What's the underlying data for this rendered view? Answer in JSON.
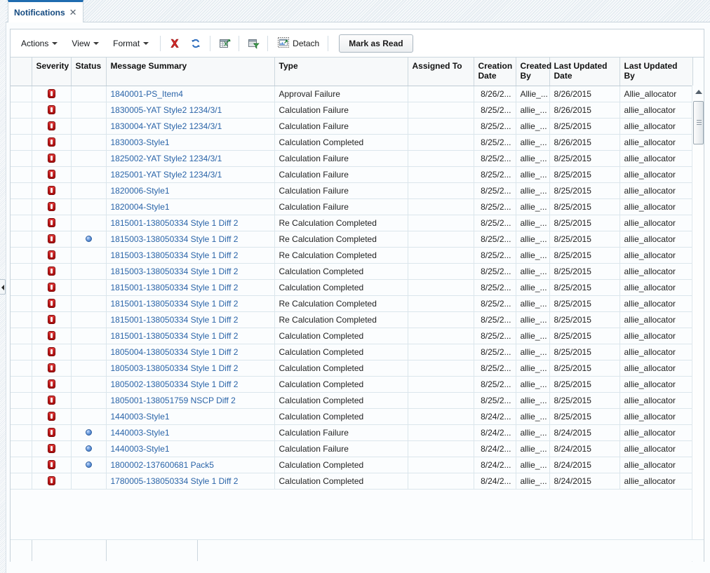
{
  "tab": {
    "label": "Notifications",
    "close_icon": "close-icon"
  },
  "toolbar": {
    "actions_label": "Actions",
    "view_label": "View",
    "format_label": "Format",
    "delete_icon": "delete-x-icon",
    "refresh_icon": "refresh-icon",
    "export_excel_icon": "export-to-excel-icon",
    "filter_icon": "query-by-example-icon",
    "detach_icon": "detach-icon",
    "detach_label": "Detach",
    "mark_as_read_label": "Mark as Read"
  },
  "table": {
    "columns": [
      "",
      "Severity",
      "Status",
      "Message Summary",
      "Type",
      "Assigned To",
      "Creation Date",
      "Created By",
      "Last Updated Date",
      "Last Updated By"
    ],
    "rows": [
      {
        "severity": "error",
        "status": "",
        "message": "1840001-PS_Item4",
        "type": "Approval Failure",
        "assigned_to": "",
        "creation_date": "8/26/2...",
        "created_by": "Allie_...",
        "last_updated_date": "8/26/2015",
        "last_updated_by": "Allie_allocator"
      },
      {
        "severity": "error",
        "status": "",
        "message": "1830005-YAT Style2 1234/3/1",
        "type": "Calculation Failure",
        "assigned_to": "",
        "creation_date": "8/25/2...",
        "created_by": "allie_...",
        "last_updated_date": "8/26/2015",
        "last_updated_by": "allie_allocator"
      },
      {
        "severity": "error",
        "status": "",
        "message": "1830004-YAT Style2 1234/3/1",
        "type": "Calculation Failure",
        "assigned_to": "",
        "creation_date": "8/25/2...",
        "created_by": "allie_...",
        "last_updated_date": "8/25/2015",
        "last_updated_by": "allie_allocator"
      },
      {
        "severity": "error",
        "status": "",
        "message": "1830003-Style1",
        "type": "Calculation Completed",
        "assigned_to": "",
        "creation_date": "8/25/2...",
        "created_by": "allie_...",
        "last_updated_date": "8/26/2015",
        "last_updated_by": "allie_allocator"
      },
      {
        "severity": "error",
        "status": "",
        "message": "1825002-YAT Style2 1234/3/1",
        "type": "Calculation Failure",
        "assigned_to": "",
        "creation_date": "8/25/2...",
        "created_by": "allie_...",
        "last_updated_date": "8/25/2015",
        "last_updated_by": "allie_allocator"
      },
      {
        "severity": "error",
        "status": "",
        "message": "1825001-YAT Style2 1234/3/1",
        "type": "Calculation Failure",
        "assigned_to": "",
        "creation_date": "8/25/2...",
        "created_by": "allie_...",
        "last_updated_date": "8/25/2015",
        "last_updated_by": "allie_allocator"
      },
      {
        "severity": "error",
        "status": "",
        "message": "1820006-Style1",
        "type": "Calculation Failure",
        "assigned_to": "",
        "creation_date": "8/25/2...",
        "created_by": "allie_...",
        "last_updated_date": "8/25/2015",
        "last_updated_by": "allie_allocator"
      },
      {
        "severity": "error",
        "status": "",
        "message": "1820004-Style1",
        "type": "Calculation Failure",
        "assigned_to": "",
        "creation_date": "8/25/2...",
        "created_by": "allie_...",
        "last_updated_date": "8/25/2015",
        "last_updated_by": "allie_allocator"
      },
      {
        "severity": "error",
        "status": "",
        "message": "1815001-138050334 Style 1 Diff 2",
        "type": "Re Calculation Completed",
        "assigned_to": "",
        "creation_date": "8/25/2...",
        "created_by": "allie_...",
        "last_updated_date": "8/25/2015",
        "last_updated_by": "allie_allocator"
      },
      {
        "severity": "error",
        "status": "unread",
        "message": "1815003-138050334 Style 1 Diff 2",
        "type": "Re Calculation Completed",
        "assigned_to": "",
        "creation_date": "8/25/2...",
        "created_by": "allie_...",
        "last_updated_date": "8/25/2015",
        "last_updated_by": "allie_allocator"
      },
      {
        "severity": "error",
        "status": "",
        "message": "1815003-138050334 Style 1 Diff 2",
        "type": "Re Calculation Completed",
        "assigned_to": "",
        "creation_date": "8/25/2...",
        "created_by": "allie_...",
        "last_updated_date": "8/25/2015",
        "last_updated_by": "allie_allocator"
      },
      {
        "severity": "error",
        "status": "",
        "message": "1815003-138050334 Style 1 Diff 2",
        "type": "Calculation Completed",
        "assigned_to": "",
        "creation_date": "8/25/2...",
        "created_by": "allie_...",
        "last_updated_date": "8/25/2015",
        "last_updated_by": "allie_allocator"
      },
      {
        "severity": "error",
        "status": "",
        "message": "1815001-138050334 Style 1 Diff 2",
        "type": "Calculation Completed",
        "assigned_to": "",
        "creation_date": "8/25/2...",
        "created_by": "allie_...",
        "last_updated_date": "8/25/2015",
        "last_updated_by": "allie_allocator"
      },
      {
        "severity": "error",
        "status": "",
        "message": "1815001-138050334 Style 1 Diff 2",
        "type": "Re Calculation Completed",
        "assigned_to": "",
        "creation_date": "8/25/2...",
        "created_by": "allie_...",
        "last_updated_date": "8/25/2015",
        "last_updated_by": "allie_allocator"
      },
      {
        "severity": "error",
        "status": "",
        "message": "1815001-138050334 Style 1 Diff 2",
        "type": "Re Calculation Completed",
        "assigned_to": "",
        "creation_date": "8/25/2...",
        "created_by": "allie_...",
        "last_updated_date": "8/25/2015",
        "last_updated_by": "allie_allocator"
      },
      {
        "severity": "error",
        "status": "",
        "message": "1815001-138050334 Style 1 Diff 2",
        "type": "Calculation Completed",
        "assigned_to": "",
        "creation_date": "8/25/2...",
        "created_by": "allie_...",
        "last_updated_date": "8/25/2015",
        "last_updated_by": "allie_allocator"
      },
      {
        "severity": "error",
        "status": "",
        "message": "1805004-138050334 Style 1 Diff 2",
        "type": "Calculation Completed",
        "assigned_to": "",
        "creation_date": "8/25/2...",
        "created_by": "allie_...",
        "last_updated_date": "8/25/2015",
        "last_updated_by": "allie_allocator"
      },
      {
        "severity": "error",
        "status": "",
        "message": "1805003-138050334 Style 1 Diff 2",
        "type": "Calculation Completed",
        "assigned_to": "",
        "creation_date": "8/25/2...",
        "created_by": "allie_...",
        "last_updated_date": "8/25/2015",
        "last_updated_by": "allie_allocator"
      },
      {
        "severity": "error",
        "status": "",
        "message": "1805002-138050334 Style 1 Diff 2",
        "type": "Calculation Completed",
        "assigned_to": "",
        "creation_date": "8/25/2...",
        "created_by": "allie_...",
        "last_updated_date": "8/25/2015",
        "last_updated_by": "allie_allocator"
      },
      {
        "severity": "error",
        "status": "",
        "message": "1805001-138051759 NSCP Diff 2",
        "type": "Calculation Completed",
        "assigned_to": "",
        "creation_date": "8/25/2...",
        "created_by": "allie_...",
        "last_updated_date": "8/25/2015",
        "last_updated_by": "allie_allocator"
      },
      {
        "severity": "error",
        "status": "",
        "message": "1440003-Style1",
        "type": "Calculation Completed",
        "assigned_to": "",
        "creation_date": "8/24/2...",
        "created_by": "allie_...",
        "last_updated_date": "8/25/2015",
        "last_updated_by": "allie_allocator"
      },
      {
        "severity": "error",
        "status": "unread",
        "message": "1440003-Style1",
        "type": "Calculation Failure",
        "assigned_to": "",
        "creation_date": "8/24/2...",
        "created_by": "allie_...",
        "last_updated_date": "8/24/2015",
        "last_updated_by": "allie_allocator"
      },
      {
        "severity": "error",
        "status": "unread",
        "message": "1440003-Style1",
        "type": "Calculation Failure",
        "assigned_to": "",
        "creation_date": "8/24/2...",
        "created_by": "allie_...",
        "last_updated_date": "8/24/2015",
        "last_updated_by": "allie_allocator"
      },
      {
        "severity": "error",
        "status": "unread",
        "message": "1800002-137600681 Pack5",
        "type": "Calculation Completed",
        "assigned_to": "",
        "creation_date": "8/24/2...",
        "created_by": "allie_...",
        "last_updated_date": "8/24/2015",
        "last_updated_by": "allie_allocator"
      },
      {
        "severity": "error",
        "status": "",
        "message": "1780005-138050334 Style 1 Diff 2",
        "type": "Calculation Completed",
        "assigned_to": "",
        "creation_date": "8/24/2...",
        "created_by": "allie_...",
        "last_updated_date": "8/24/2015",
        "last_updated_by": "allie_allocator"
      }
    ]
  },
  "colors": {
    "link": "#2a64a8",
    "tab_accent": "#1f6cb0",
    "severity_error": "#c01212",
    "status_unread": "#3f7fd0"
  }
}
